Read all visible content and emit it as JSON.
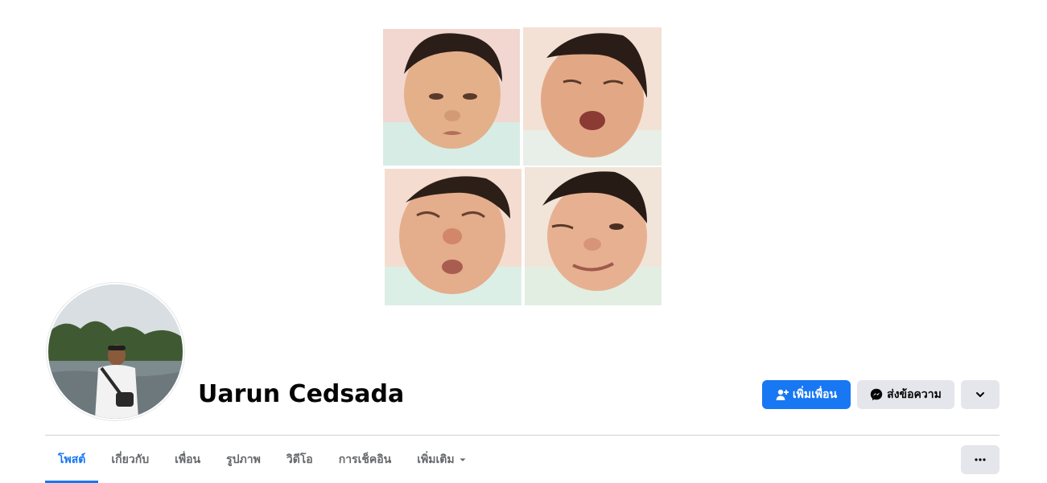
{
  "profile": {
    "name": "Uarun Cedsada",
    "cover_photo_alt": "",
    "avatar_alt": ""
  },
  "actions": {
    "add_friend_label": "เพิ่มเพื่อน",
    "message_label": "ส่งข้อความ",
    "dropdown_icon": "chevron-down-icon"
  },
  "tabs": [
    {
      "label": "โพสต์",
      "active": true
    },
    {
      "label": "เกี่ยวกับ",
      "active": false
    },
    {
      "label": "เพื่อน",
      "active": false
    },
    {
      "label": "รูปภาพ",
      "active": false
    },
    {
      "label": "วิดีโอ",
      "active": false
    },
    {
      "label": "การเช็คอิน",
      "active": false
    },
    {
      "label": "เพิ่มเติม",
      "active": false
    }
  ],
  "more_options_icon": "more-horizontal-icon",
  "colors": {
    "accent": "#1877f2",
    "secondary_button": "#e4e6eb",
    "tab_inactive": "#65676b",
    "divider": "#ced0d4"
  }
}
